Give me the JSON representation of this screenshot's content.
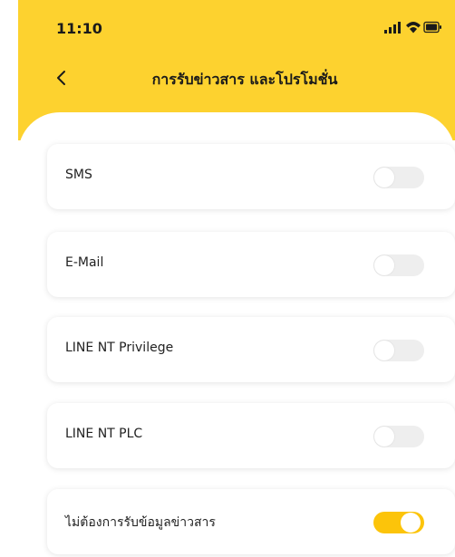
{
  "status_bar": {
    "time": "11:10",
    "icons": [
      "signal-icon",
      "wifi-icon",
      "battery-icon"
    ]
  },
  "header": {
    "title": "การรับข่าวสาร และโปรโมชั่น",
    "back_icon": "chevron-left-icon"
  },
  "colors": {
    "header_bg": "#fdd22f",
    "toggle_on": "#fcc40a",
    "toggle_off": "#eeeeee"
  },
  "options": [
    {
      "label": "SMS",
      "enabled": false
    },
    {
      "label": "E-Mail",
      "enabled": false
    },
    {
      "label": "LINE NT Privilege",
      "enabled": false
    },
    {
      "label": "LINE NT PLC",
      "enabled": false
    },
    {
      "label": "ไม่ต้องการรับข้อมูลข่าวสาร",
      "enabled": true
    }
  ]
}
